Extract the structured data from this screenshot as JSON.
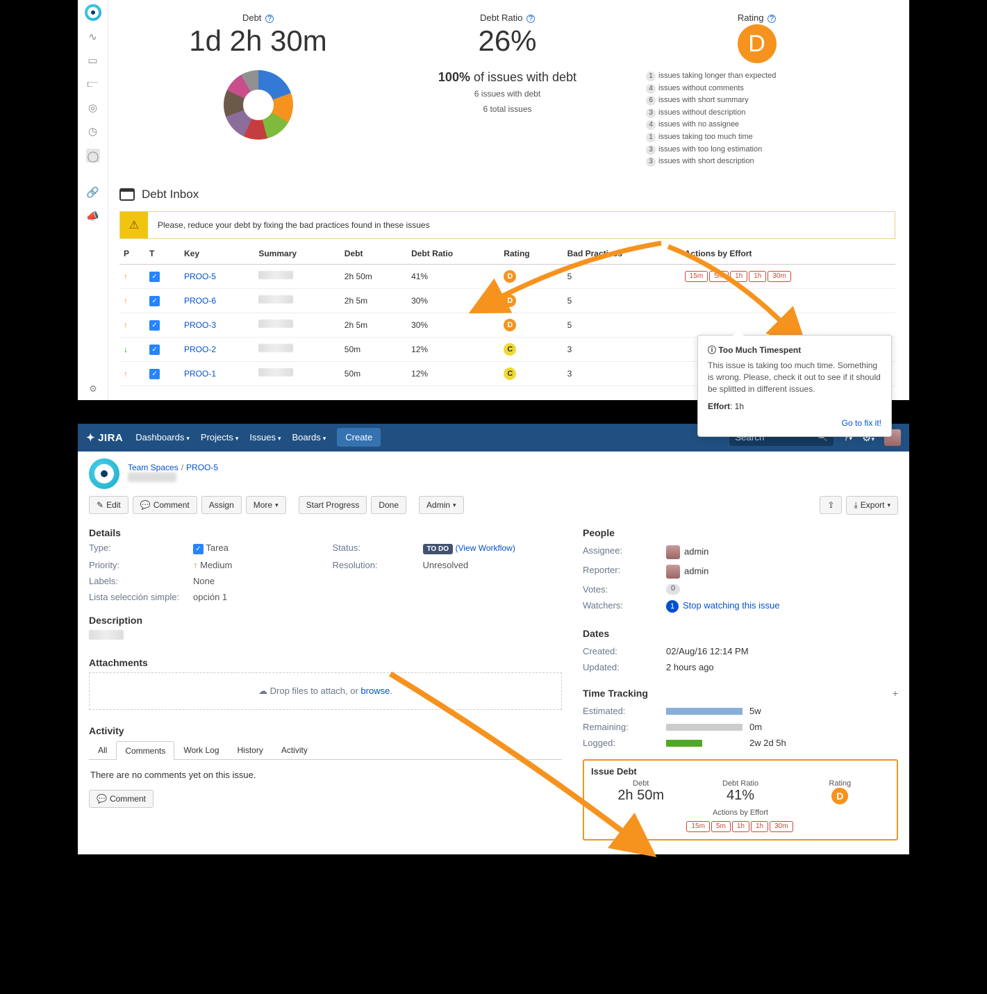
{
  "top": {
    "metrics": {
      "debt_label": "Debt",
      "debt_value": "1d 2h 30m",
      "ratio_label": "Debt Ratio",
      "ratio_value": "26%",
      "rating_label": "Rating",
      "rating_value": "D"
    },
    "issues_summary": {
      "pct_line_strong": "100%",
      "pct_line_rest": " of issues with debt",
      "l1": "6 issues with debt",
      "l2": "6 total issues"
    },
    "debt_causes": [
      {
        "count": "1",
        "text": "issues taking longer than expected"
      },
      {
        "count": "4",
        "text": "issues without comments"
      },
      {
        "count": "6",
        "text": "issues with short summary"
      },
      {
        "count": "3",
        "text": "issues without description"
      },
      {
        "count": "4",
        "text": "issues with no assignee"
      },
      {
        "count": "1",
        "text": "issues taking too much time"
      },
      {
        "count": "3",
        "text": "issues with too long estimation"
      },
      {
        "count": "3",
        "text": "issues with short description"
      }
    ],
    "inbox_title": "Debt Inbox",
    "warning": "Please, reduce your debt by fixing the bad practices found in these issues",
    "columns": {
      "p": "P",
      "t": "T",
      "key": "Key",
      "summary": "Summary",
      "debt": "Debt",
      "ratio": "Debt Ratio",
      "rating": "Rating",
      "bad": "Bad Practices",
      "actions": "Actions by Effort"
    },
    "rows": [
      {
        "p": "up",
        "key": "PROO-5",
        "debt": "2h 50m",
        "ratio": "41%",
        "rating": "D",
        "bad": "5",
        "efforts": [
          "15m",
          "5m",
          "1h",
          "1h",
          "30m"
        ]
      },
      {
        "p": "up",
        "key": "PROO-6",
        "debt": "2h 5m",
        "ratio": "30%",
        "rating": "D",
        "bad": "5"
      },
      {
        "p": "up",
        "key": "PROO-3",
        "debt": "2h 5m",
        "ratio": "30%",
        "rating": "D",
        "bad": "5"
      },
      {
        "p": "down",
        "key": "PROO-2",
        "debt": "50m",
        "ratio": "12%",
        "rating": "C",
        "bad": "3"
      },
      {
        "p": "up",
        "key": "PROO-1",
        "debt": "50m",
        "ratio": "12%",
        "rating": "C",
        "bad": "3"
      }
    ],
    "tooltip": {
      "title": "Too Much Timespent",
      "body": "This issue is taking too much time. Something is wrong. Please, check it out to see if it should be splitted in different issues.",
      "effort_lbl": "Effort",
      "effort_val": "1h",
      "link": "Go to fix it!"
    }
  },
  "jira": {
    "nav": {
      "logo": "JIRA",
      "dashboards": "Dashboards",
      "projects": "Projects",
      "issues": "Issues",
      "boards": "Boards",
      "create": "Create",
      "search_ph": "Search"
    },
    "breadcrumb": {
      "space": "Team Spaces",
      "key": "PROO-5"
    },
    "toolbar": {
      "edit": "Edit",
      "comment": "Comment",
      "assign": "Assign",
      "more": "More",
      "start": "Start Progress",
      "done": "Done",
      "admin": "Admin",
      "export": "Export"
    },
    "details": {
      "section": "Details",
      "type_lbl": "Type:",
      "type_val": "Tarea",
      "priority_lbl": "Priority:",
      "priority_val": "Medium",
      "labels_lbl": "Labels:",
      "labels_val": "None",
      "lista_lbl": "Lista selección simple:",
      "lista_val": "opción 1",
      "status_lbl": "Status:",
      "status_badge": "TO DO",
      "workflow": "(View Workflow)",
      "resolution_lbl": "Resolution:",
      "resolution_val": "Unresolved"
    },
    "description": {
      "section": "Description"
    },
    "attachments": {
      "section": "Attachments",
      "drop_pre": "Drop files to attach, or ",
      "drop_link": "browse",
      "drop_post": "."
    },
    "activity": {
      "section": "Activity",
      "tabs": {
        "all": "All",
        "comments": "Comments",
        "worklog": "Work Log",
        "history": "History",
        "act": "Activity"
      },
      "empty": "There are no comments yet on this issue.",
      "comment_btn": "Comment"
    },
    "people": {
      "section": "People",
      "assignee_lbl": "Assignee:",
      "assignee_val": "admin",
      "reporter_lbl": "Reporter:",
      "reporter_val": "admin",
      "votes_lbl": "Votes:",
      "votes_val": "0",
      "watchers_lbl": "Watchers:",
      "watchers_count": "1",
      "watchers_link": "Stop watching this issue"
    },
    "dates": {
      "section": "Dates",
      "created_lbl": "Created:",
      "created_val": "02/Aug/16 12:14 PM",
      "updated_lbl": "Updated:",
      "updated_val": "2 hours ago"
    },
    "tracking": {
      "section": "Time Tracking",
      "est_lbl": "Estimated:",
      "est_val": "5w",
      "rem_lbl": "Remaining:",
      "rem_val": "0m",
      "log_lbl": "Logged:",
      "log_val": "2w 2d 5h"
    },
    "issue_debt": {
      "section": "Issue Debt",
      "debt_lbl": "Debt",
      "debt_val": "2h 50m",
      "ratio_lbl": "Debt Ratio",
      "ratio_val": "41%",
      "rating_lbl": "Rating",
      "rating_val": "D",
      "actions_lbl": "Actions by Effort",
      "efforts": [
        "15m",
        "5m",
        "1h",
        "1h",
        "30m"
      ]
    }
  }
}
